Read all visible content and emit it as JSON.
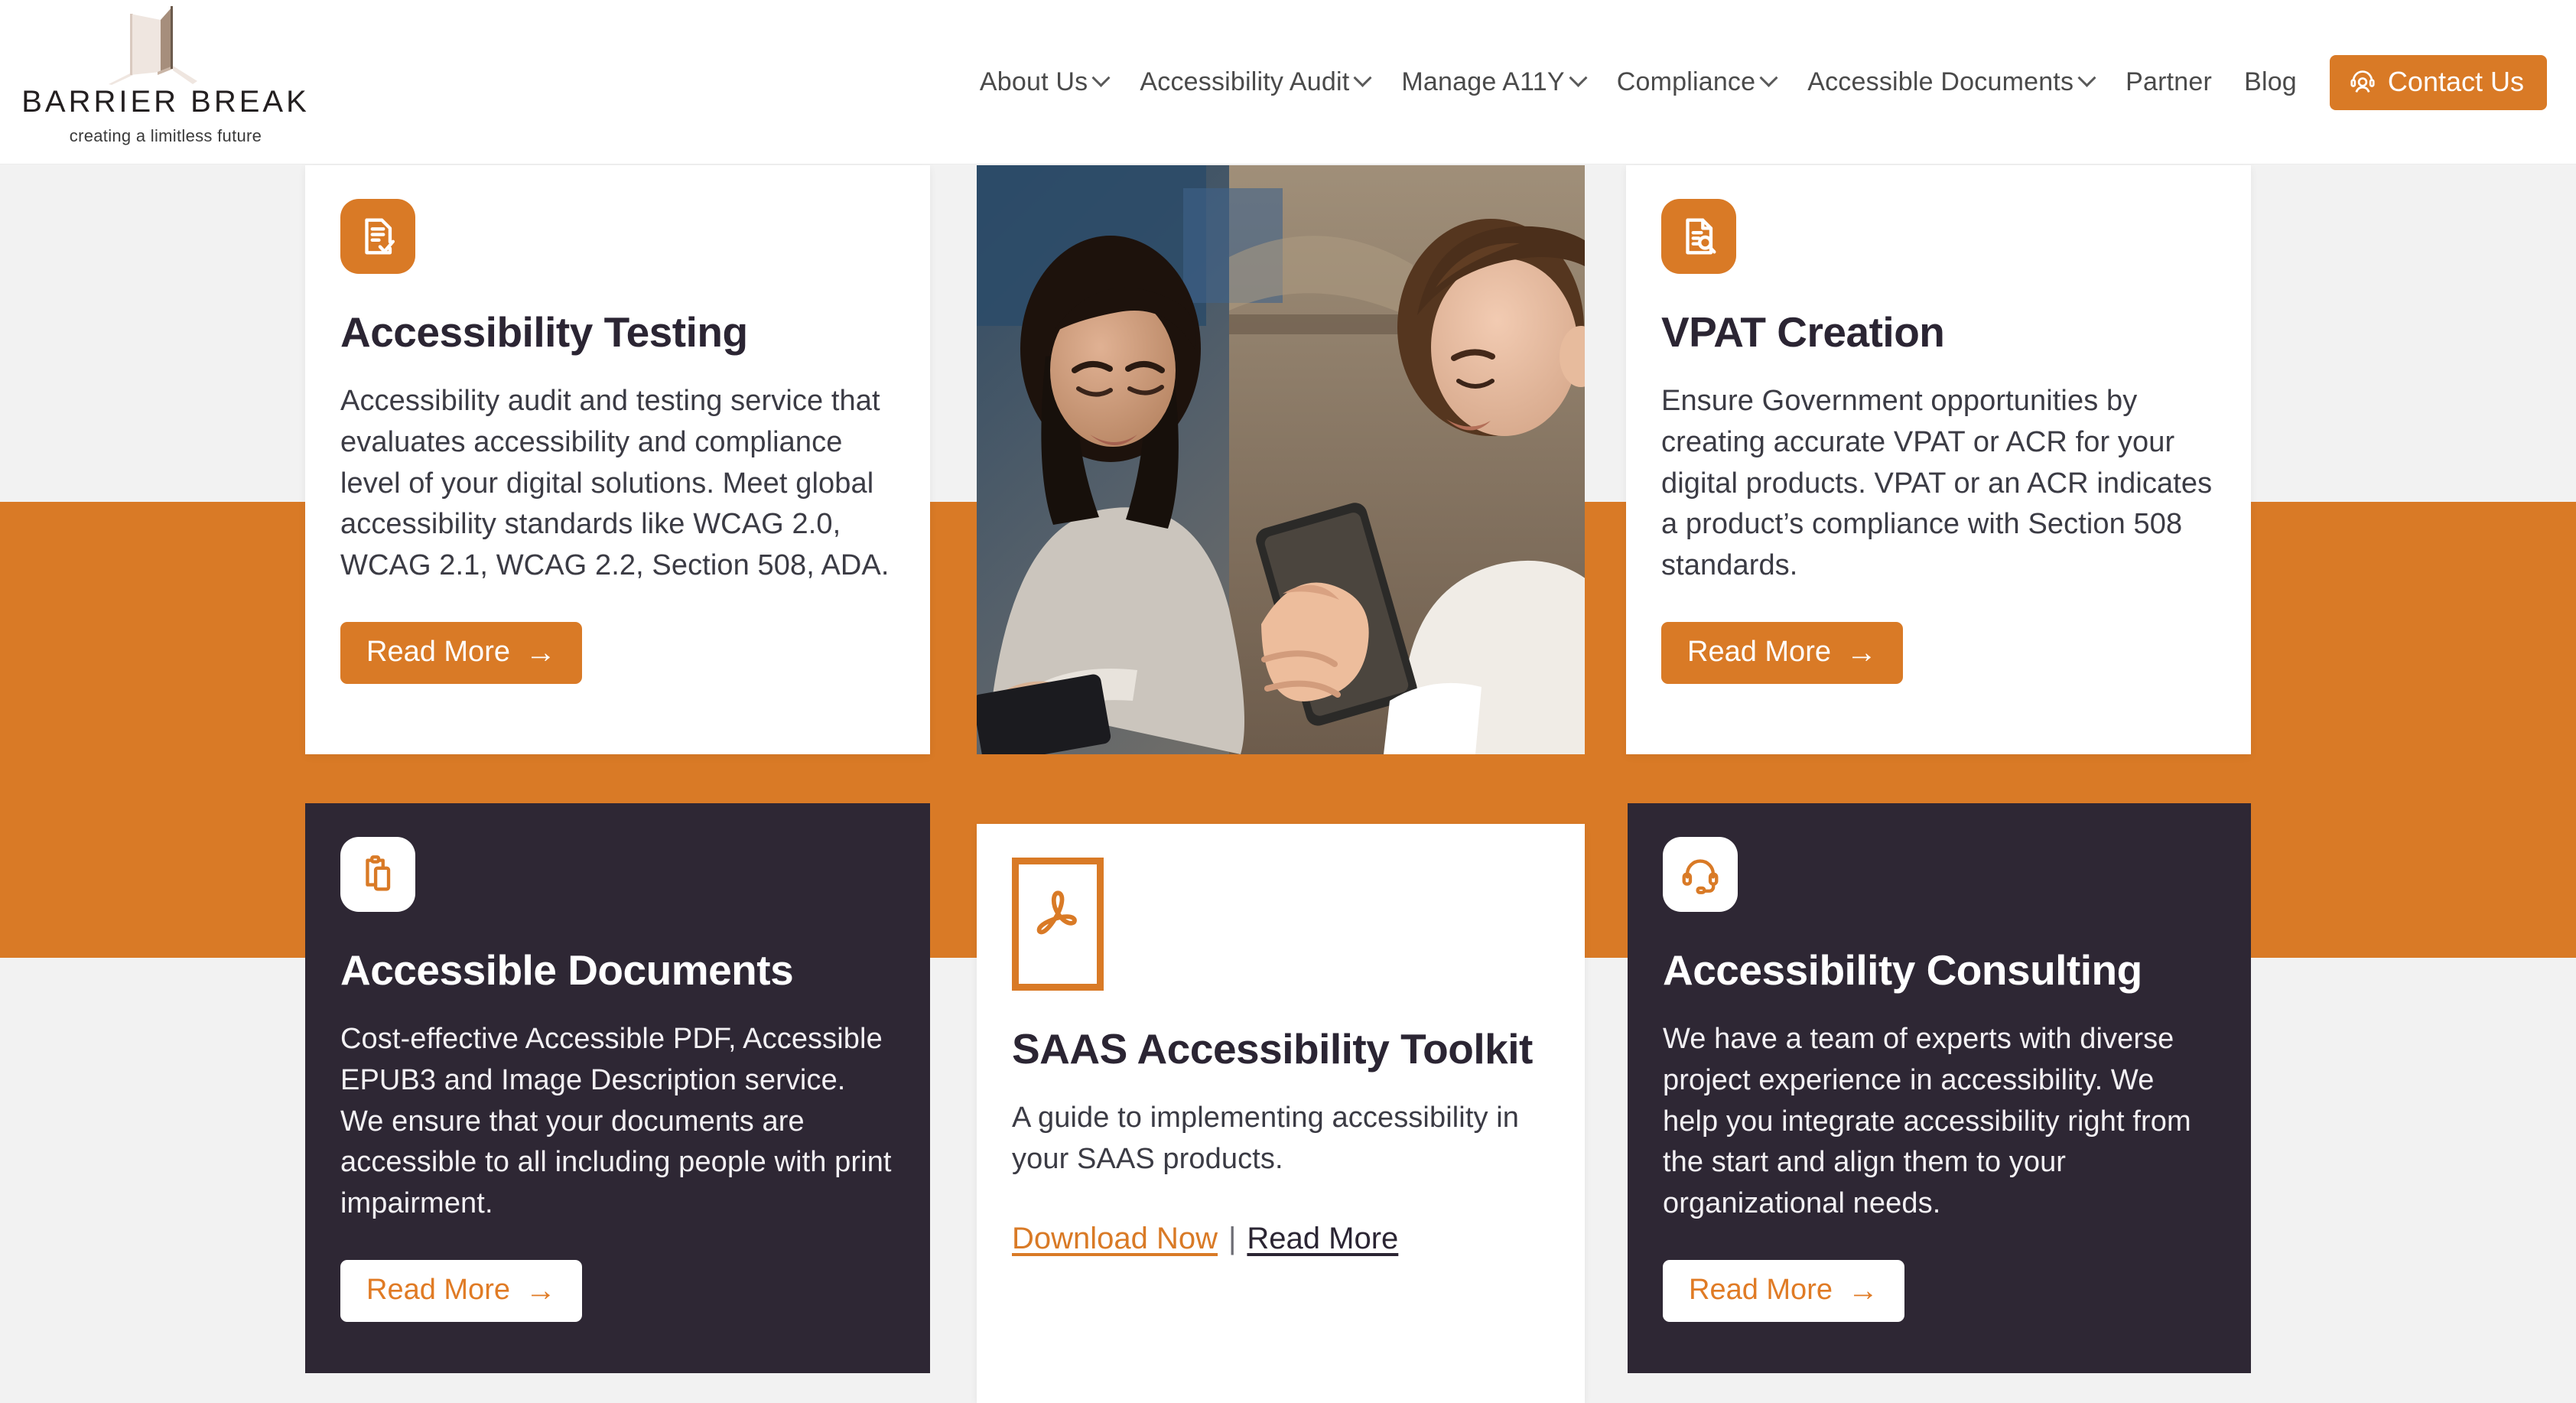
{
  "brand": {
    "name": "BARRIER BREAK",
    "tagline": "creating a limitless future",
    "logo_icon": "open-door-logo",
    "accent_color": "#d97a26",
    "dark_color": "#2e2734",
    "page_bg": "#f2f2f2"
  },
  "nav": {
    "items": [
      {
        "label": "About Us",
        "has_dropdown": true
      },
      {
        "label": "Accessibility Audit",
        "has_dropdown": true
      },
      {
        "label": "Manage A11Y",
        "has_dropdown": true
      },
      {
        "label": "Compliance",
        "has_dropdown": true
      },
      {
        "label": "Accessible Documents",
        "has_dropdown": true
      },
      {
        "label": "Partner",
        "has_dropdown": false
      },
      {
        "label": "Blog",
        "has_dropdown": false
      }
    ],
    "contact": {
      "label": "Contact Us",
      "icon": "headset-person-icon"
    }
  },
  "cards": [
    {
      "id": "accessibility-testing",
      "theme": "white",
      "icon": "document-check-icon",
      "title": "Accessibility Testing",
      "body": "Accessibility audit and testing service that evaluates accessibility and compliance level of your digital solutions. Meet global accessibility standards like WCAG 2.0, WCAG 2.1, WCAG 2.2, Section 508, ADA.",
      "cta": {
        "label": "Read More",
        "arrow": "→",
        "style": "solid"
      }
    },
    {
      "id": "people-photo",
      "theme": "photo",
      "alt": "Two people sitting together looking at a mobile phone and a tablet"
    },
    {
      "id": "vpat-creation",
      "theme": "white",
      "icon": "document-search-icon",
      "title": "VPAT Creation",
      "body": "Ensure Government opportunities by creating accurate VPAT or ACR for your digital products. VPAT or an ACR indicates a product’s compliance with Section 508 standards.",
      "cta": {
        "label": "Read More",
        "arrow": "→",
        "style": "solid"
      }
    },
    {
      "id": "accessible-documents",
      "theme": "dark",
      "icon": "clipboard-copy-icon",
      "title": "Accessible Documents",
      "body": "Cost-effective Accessible PDF, Accessible EPUB3 and Image Description service. We ensure that your documents are accessible to all including people with print impairment.",
      "cta": {
        "label": "Read More",
        "arrow": "→",
        "style": "ghost"
      }
    },
    {
      "id": "saas-accessibility-toolkit",
      "theme": "white",
      "icon": "pdf-acrobat-icon",
      "title": "SAAS Accessibility Toolkit",
      "body": "A guide to implementing accessibility in your SAAS products.",
      "links": {
        "download": "Download Now",
        "separator": "|",
        "read_more": "Read More"
      }
    },
    {
      "id": "accessibility-consulting",
      "theme": "dark",
      "icon": "headset-icon",
      "title": "Accessibility Consulting",
      "body": "We have a team of experts with diverse project experience in accessibility. We help you integrate accessibility right from the start and align them to your organizational needs.",
      "cta": {
        "label": "Read More",
        "arrow": "→",
        "style": "ghost"
      }
    }
  ]
}
